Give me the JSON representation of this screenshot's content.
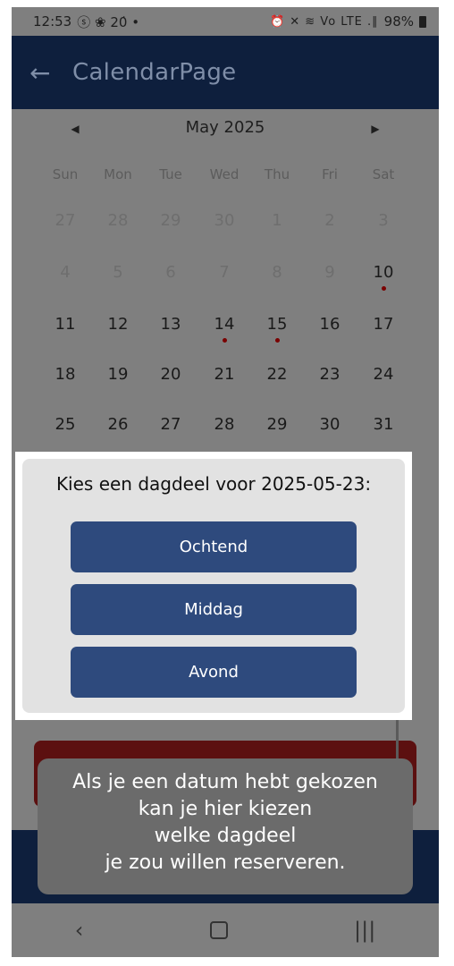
{
  "status_bar": {
    "time": "12:53",
    "left_icons": "ⓢ ❀ 20̇ •",
    "right_icons": "⏰ ✕ ≋ Vo LTE .∥",
    "battery": "98%"
  },
  "app_bar": {
    "back_icon": "←",
    "title": "CalendarPage"
  },
  "calendar": {
    "prev_icon": "◀",
    "next_icon": "▶",
    "month_label": "May 2025",
    "weekdays": [
      "Sun",
      "Mon",
      "Tue",
      "Wed",
      "Thu",
      "Fri",
      "Sat"
    ],
    "rows": [
      [
        "27",
        "28",
        "29",
        "30",
        "1",
        "2",
        "3"
      ],
      [
        "4",
        "5",
        "6",
        "7",
        "8",
        "9",
        "10"
      ],
      [
        "11",
        "12",
        "13",
        "14",
        "15",
        "16",
        "17"
      ],
      [
        "18",
        "19",
        "20",
        "21",
        "22",
        "23",
        "24"
      ],
      [
        "25",
        "26",
        "27",
        "28",
        "29",
        "30",
        "31"
      ]
    ]
  },
  "dialog": {
    "prompt": "Kies een dagdeel voor 2025-05-23:",
    "options": [
      "Ochtend",
      "Middag",
      "Avond"
    ]
  },
  "tooltip": {
    "lines": [
      "Als je een datum hebt gekozen",
      "kan je hier kiezen",
      "welke dagdeel",
      "je zou willen reserveren."
    ]
  },
  "nav_bar": {
    "back_icon": "‹",
    "home_icon": "home",
    "recents_icon": "|||"
  },
  "colors": {
    "app_bar": "#0e1f3d",
    "button": "#2e4a7d",
    "event_dot": "#7a0000"
  }
}
